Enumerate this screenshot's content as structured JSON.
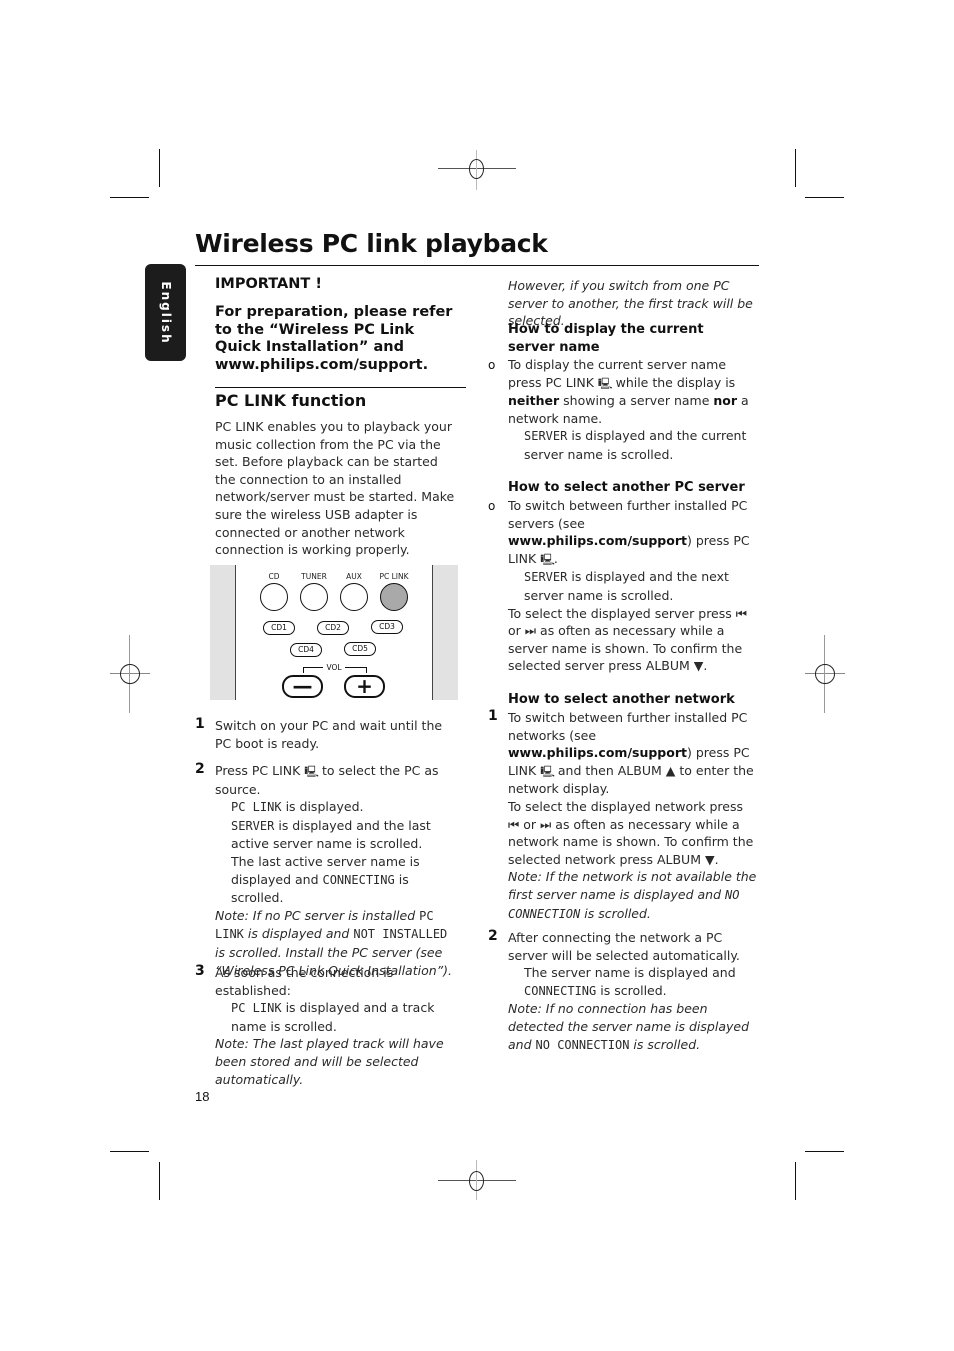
{
  "page": {
    "title": "Wireless PC link playback",
    "language_tab": "English",
    "page_number": "18"
  },
  "left_column": {
    "important_heading": "IMPORTANT !",
    "important_text": "For preparation, please refer to the “Wireless PC Link Quick Installation” and www.philips.com/support.",
    "section_heading": "PC LINK function",
    "intro": "PC LINK enables you to playback your music collection from the PC via the set. Before playback can be started the connection to an installed network/server must be started. Make sure the wireless USB adapter is connected or another network connection is working properly.",
    "remote": {
      "source_buttons": [
        "CD",
        "TUNER",
        "AUX",
        "PC LINK"
      ],
      "highlighted_button": "PC LINK",
      "cd_buttons": [
        "CD1",
        "CD2",
        "CD3",
        "CD4",
        "CD5"
      ],
      "vol_label": "VOL",
      "vol_minus": "—",
      "vol_plus": "+"
    },
    "steps": [
      {
        "num": "1",
        "text": "Switch on your PC and wait until the PC boot is ready."
      },
      {
        "num": "2",
        "text_a": "Press PC LINK",
        "text_b": "to select the PC as source.",
        "r1_mono": "PC LINK",
        "r1_text": "is displayed.",
        "r2_mono": "SERVER",
        "r2_text": "is displayed and the last active server name is scrolled.",
        "r3_text": "The last active server name is displayed and",
        "r3_mono": "CONNECTING",
        "r3_tail": "is scrolled.",
        "note_a": "Note: If no PC server is installed",
        "note_mono1": "PC LINK",
        "note_b": "is displayed and",
        "note_mono2": "NOT INSTALLED",
        "note_c": "is scrolled. Install the PC server (see “Wireless PC Link Quick Installation”)."
      },
      {
        "num": "3",
        "text": "As soon as the connection is established:",
        "r1_mono": "PC LINK",
        "r1_text": "is displayed and a track name is scrolled.",
        "note": "Note: The last played track will have been stored and will be selected automatically."
      }
    ]
  },
  "right_column": {
    "note_top": "However, if you switch from one PC server to another, the first track will be selected.",
    "display_server": {
      "heading": "How to display the current server name",
      "bullet": "o",
      "text_a": "To display the current server name press PC LINK",
      "text_b": "while the display is",
      "bold1": "neither",
      "text_c": "showing a server name",
      "bold2": "nor",
      "text_d": "a network name.",
      "r1_mono": "SERVER",
      "r1_text": "is displayed and the current server name is scrolled."
    },
    "select_server": {
      "heading": "How to select another PC server",
      "bullet": "o",
      "text_a": "To switch between further installed PC servers (see",
      "link": "www.philips.com/support",
      "text_b": ") press PC LINK",
      "text_c": ".",
      "r1_mono": "SERVER",
      "r1_text": "is displayed and the next server name is scrolled.",
      "text_d": "To select the displayed server press",
      "prev_icon": "⏮",
      "text_e": "or",
      "next_icon": "⏭",
      "text_f": "as often as necessary while a server name is shown. To confirm the selected server press ALBUM",
      "down_icon": "▼",
      "text_g": "."
    },
    "select_network": {
      "heading": "How to select another network",
      "step1": {
        "num": "1",
        "text_a": "To switch between further installed PC networks (see",
        "link": "www.philips.com/support",
        "text_b": ") press PC LINK",
        "text_c": "and then ALBUM",
        "up_icon": "▲",
        "text_d": "to enter the network display.",
        "text_e": "To select the displayed network press",
        "prev_icon": "⏮",
        "text_f": "or",
        "next_icon": "⏭",
        "text_g": "as often as necessary while a network name is shown. To confirm the selected network press ALBUM",
        "down_icon": "▼",
        "text_h": ".",
        "note_a": "Note: If the network is not available the first server name is displayed and",
        "note_mono": "NO CONNECTION",
        "note_b": "is scrolled."
      },
      "step2": {
        "num": "2",
        "text": "After connecting the network a PC server will be selected automatically.",
        "r1_text": "The server name is displayed and",
        "r1_mono": "CONNECTING",
        "r1_tail": "is scrolled.",
        "note_a": "Note: If no connection has been detected the server name is displayed and",
        "note_mono": "NO CONNECTION",
        "note_b": "is scrolled."
      }
    }
  },
  "icons": {
    "pc_link": "🖳"
  }
}
